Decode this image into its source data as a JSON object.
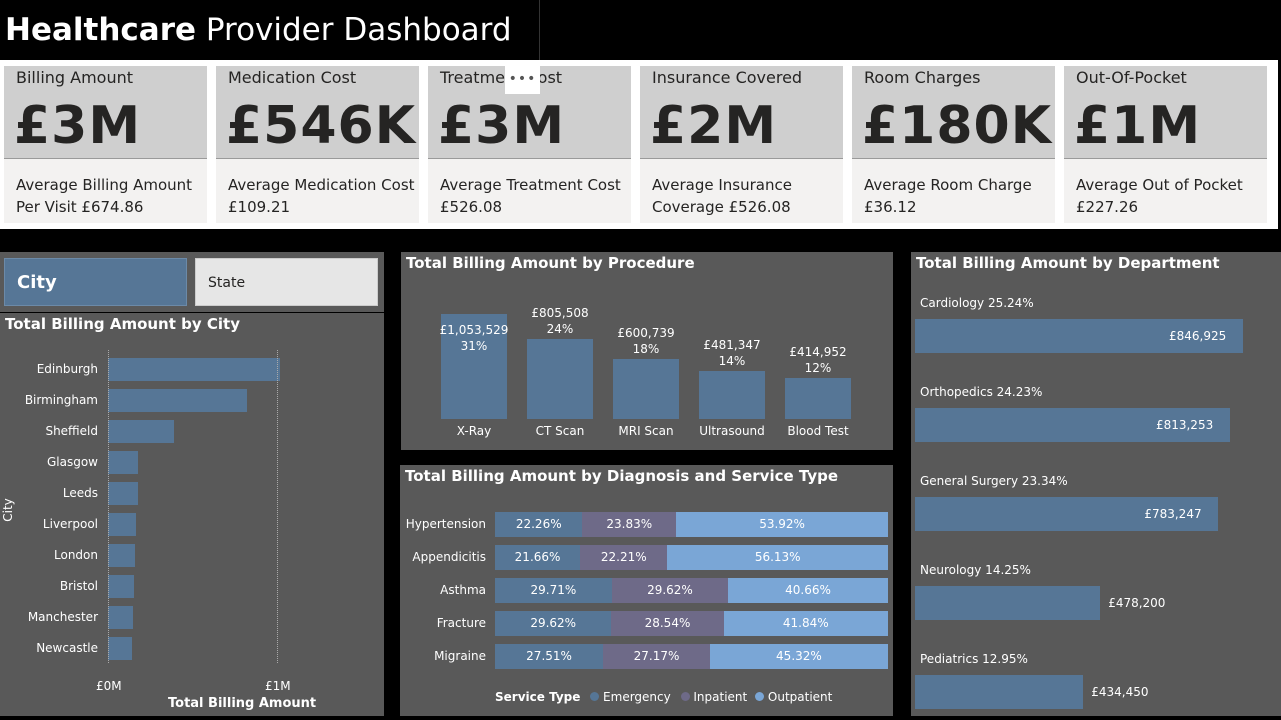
{
  "header": {
    "title_bold": "Healthcare",
    "title_rest": " Provider Dashboard"
  },
  "kpis": [
    {
      "label": "Billing Amount",
      "value": "£3M",
      "sub": "Average Billing Amount Per Visit £674.86"
    },
    {
      "label": "Medication Cost",
      "value": "£546K",
      "sub": "Average Medication Cost £109.21"
    },
    {
      "label": "Treatment Cost",
      "value": "£3M",
      "sub": "Average Treatment Cost £526.08"
    },
    {
      "label": "Insurance Covered",
      "value": "£2M",
      "sub": "Average Insurance Coverage £526.08"
    },
    {
      "label": "Room Charges",
      "value": "£180K",
      "sub": "Average Room Charge £36.12"
    },
    {
      "label": "Out-Of-Pocket",
      "value": "£1M",
      "sub": "Average Out of Pocket £227.26"
    }
  ],
  "more_options": "•••",
  "slicer": {
    "city": "City",
    "state": "State"
  },
  "colors": {
    "bar": "#567696",
    "emergency": "#567696",
    "inpatient": "#6e6a88",
    "outpatient": "#7aa6d6",
    "panel": "#595959"
  },
  "chart_data": [
    {
      "type": "bar",
      "title": "Total Billing Amount by City",
      "orientation": "horizontal",
      "categories": [
        "Edinburgh",
        "Birmingham",
        "Sheffield",
        "Glasgow",
        "Leeds",
        "Liverpool",
        "London",
        "Bristol",
        "Manchester",
        "Newcastle"
      ],
      "values": [
        1020000,
        820000,
        390000,
        180000,
        175000,
        165000,
        160000,
        155000,
        150000,
        140000
      ],
      "xlabel": "Total Billing Amount",
      "ylabel": "City",
      "xticks": [
        "£0M",
        "£1M"
      ],
      "xlim": [
        0,
        1000000
      ]
    },
    {
      "type": "bar",
      "title": "Total Billing Amount by Procedure",
      "categories": [
        "X-Ray",
        "CT Scan",
        "MRI Scan",
        "Ultrasound",
        "Blood Test"
      ],
      "values": [
        1053529,
        805508,
        600739,
        481347,
        414952
      ],
      "value_labels": [
        "£1,053,529",
        "£805,508",
        "£600,739",
        "£481,347",
        "£414,952"
      ],
      "percent_labels": [
        "31%",
        "24%",
        "18%",
        "14%",
        "12%"
      ]
    },
    {
      "type": "bar",
      "stacked": "100%",
      "title": "Total Billing Amount by Diagnosis and Service Type",
      "categories": [
        "Hypertension",
        "Appendicitis",
        "Asthma",
        "Fracture",
        "Migraine"
      ],
      "legend_title": "Service Type",
      "series": [
        {
          "name": "Emergency",
          "values": [
            22.26,
            21.66,
            29.71,
            29.62,
            27.51
          ],
          "labels": [
            "22.26%",
            "21.66%",
            "29.71%",
            "29.62%",
            "27.51%"
          ]
        },
        {
          "name": "Inpatient",
          "values": [
            23.83,
            22.21,
            29.62,
            28.54,
            27.17
          ],
          "labels": [
            "23.83%",
            "22.21%",
            "29.62%",
            "28.54%",
            "27.17%"
          ]
        },
        {
          "name": "Outpatient",
          "values": [
            53.92,
            56.13,
            40.66,
            41.84,
            45.32
          ],
          "labels": [
            "53.92%",
            "56.13%",
            "40.66%",
            "41.84%",
            "45.32%"
          ]
        }
      ]
    },
    {
      "type": "bar",
      "orientation": "horizontal",
      "title": "Total Billing Amount by Department",
      "categories": [
        "Cardiology 25.24%",
        "Orthopedics 24.23%",
        "General Surgery 23.34%",
        "Neurology 14.25%",
        "Pediatrics 12.95%"
      ],
      "values": [
        846925,
        813253,
        783247,
        478200,
        434450
      ],
      "value_labels": [
        "£846,925",
        "£813,253",
        "£783,247",
        "£478,200",
        "£434,450"
      ]
    }
  ]
}
